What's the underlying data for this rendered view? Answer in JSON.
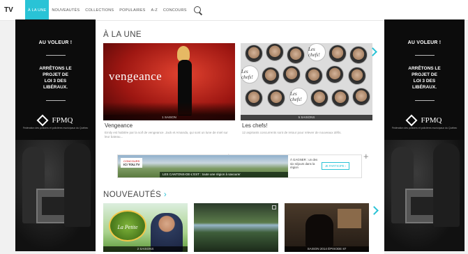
{
  "nav": {
    "logo": "TV",
    "items": [
      {
        "label": "À LA UNE",
        "active": true
      },
      {
        "label": "NOUVEAUTÉS",
        "active": false
      },
      {
        "label": "COLLECTIONS",
        "active": false
      },
      {
        "label": "POPULAIRES",
        "active": false
      },
      {
        "label": "A-Z",
        "active": false
      },
      {
        "label": "CONCOURS",
        "active": false
      }
    ],
    "accent_color": "#29c3d6"
  },
  "side_ad": {
    "headline": "AU VOLEUR !",
    "message_1": "ARRÊTONS LE",
    "message_2": "PROJET DE",
    "message_3": "LOI 3 DES",
    "message_4": "LIBÉRAUX.",
    "logo_text": "FPMQ",
    "logo_sub": "Fédération des policiers et policières municipaux du Québec"
  },
  "alaune": {
    "title": "À LA UNE",
    "cards": [
      {
        "title": "Vengeance",
        "ribbon": "1 SAISON",
        "description": "Emily est habitée par la soif de vengeance. Jack et Amanda, qui sont un lune de miel sur leur bateau...",
        "art_word": "vengeance"
      },
      {
        "title": "Les chefs!",
        "ribbon": "5 SAISONS",
        "description": "12 aspirants concurrents sont de retour pour relever de nouveaux défis.",
        "badge_text": "Les chefs!"
      }
    ]
  },
  "banner": {
    "brand_label": "CONCOURS",
    "brand_name": "ICI TOU.TV",
    "strip_text": "LES CANTONS-DE-L'EST : toute une région à savourer",
    "side_text": "À GAGNER : un des six séjours dans la région",
    "button_label": "JE PARTICIPE ›"
  },
  "nouveautes": {
    "title": "NOUVEAUTÉS",
    "cards": [
      {
        "ribbon": "2 SAISONS",
        "sign_text": "La Petite Séduction"
      },
      {
        "ribbon": ""
      },
      {
        "ribbon": "SAISON 2014 ÉPISODE 87"
      }
    ]
  }
}
